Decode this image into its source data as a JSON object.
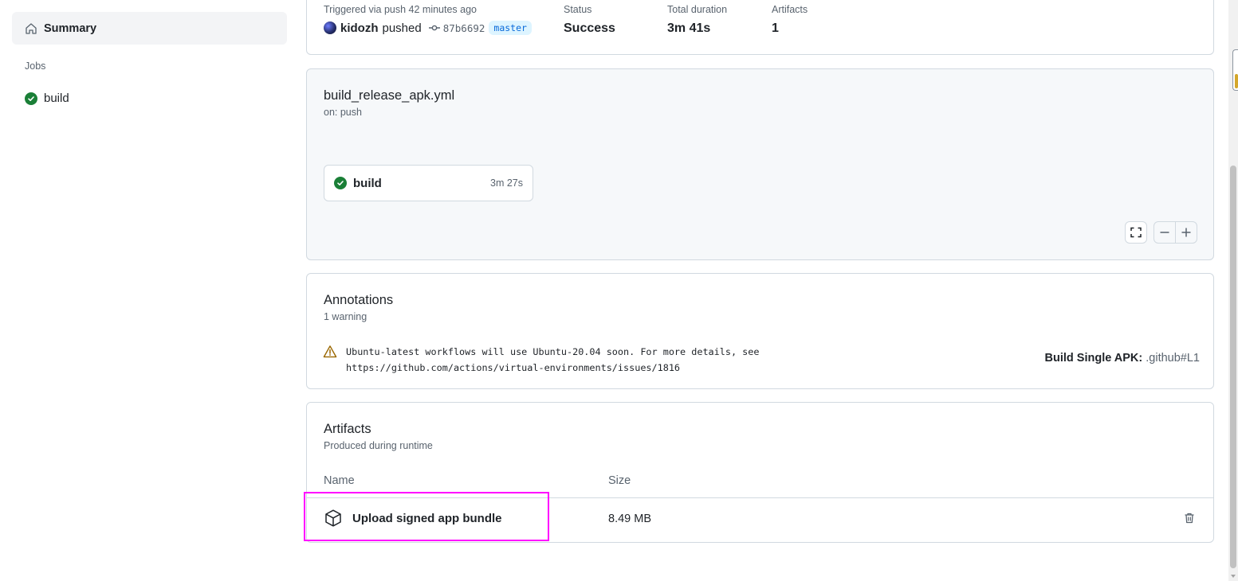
{
  "sidebar": {
    "summary_label": "Summary",
    "jobs_heading": "Jobs",
    "jobs": [
      {
        "label": "build",
        "status": "success"
      }
    ]
  },
  "run_summary": {
    "trigger_label": "Triggered via push 42 minutes ago",
    "actor": "kidozh",
    "action": "pushed",
    "commit_sha": "87b6692",
    "branch": "master",
    "status_label": "Status",
    "status_value": "Success",
    "duration_label": "Total duration",
    "duration_value": "3m 41s",
    "artifacts_label": "Artifacts",
    "artifacts_value": "1"
  },
  "workflow": {
    "file": "build_release_apk.yml",
    "trigger": "on: push",
    "job": {
      "name": "build",
      "duration": "3m 27s",
      "status": "success"
    }
  },
  "annotations": {
    "title": "Annotations",
    "subtitle": "1 warning",
    "items": [
      {
        "level": "warning",
        "message": "Ubuntu-latest workflows will use Ubuntu-20.04 soon. For more details, see https://github.com/actions/virtual-environments/issues/1816",
        "job": "Build Single APK:",
        "location": ".github#L1"
      }
    ]
  },
  "artifacts": {
    "title": "Artifacts",
    "subtitle": "Produced during runtime",
    "columns": [
      "Name",
      "Size"
    ],
    "rows": [
      {
        "name": "Upload signed app bundle",
        "size": "8.49 MB"
      }
    ]
  },
  "colors": {
    "success": "#1a7f37",
    "warning": "#9a6700",
    "link": "#0969da",
    "highlight": "#ff00ff"
  },
  "icons": {
    "summary": "home-icon",
    "job_status": "check-circle-icon",
    "commit": "git-commit-icon",
    "fullscreen": "screen-full-icon",
    "zoom_out": "dash-icon",
    "zoom_in": "plus-icon",
    "warning": "alert-icon",
    "artifact": "package-icon",
    "delete": "trash-icon"
  }
}
